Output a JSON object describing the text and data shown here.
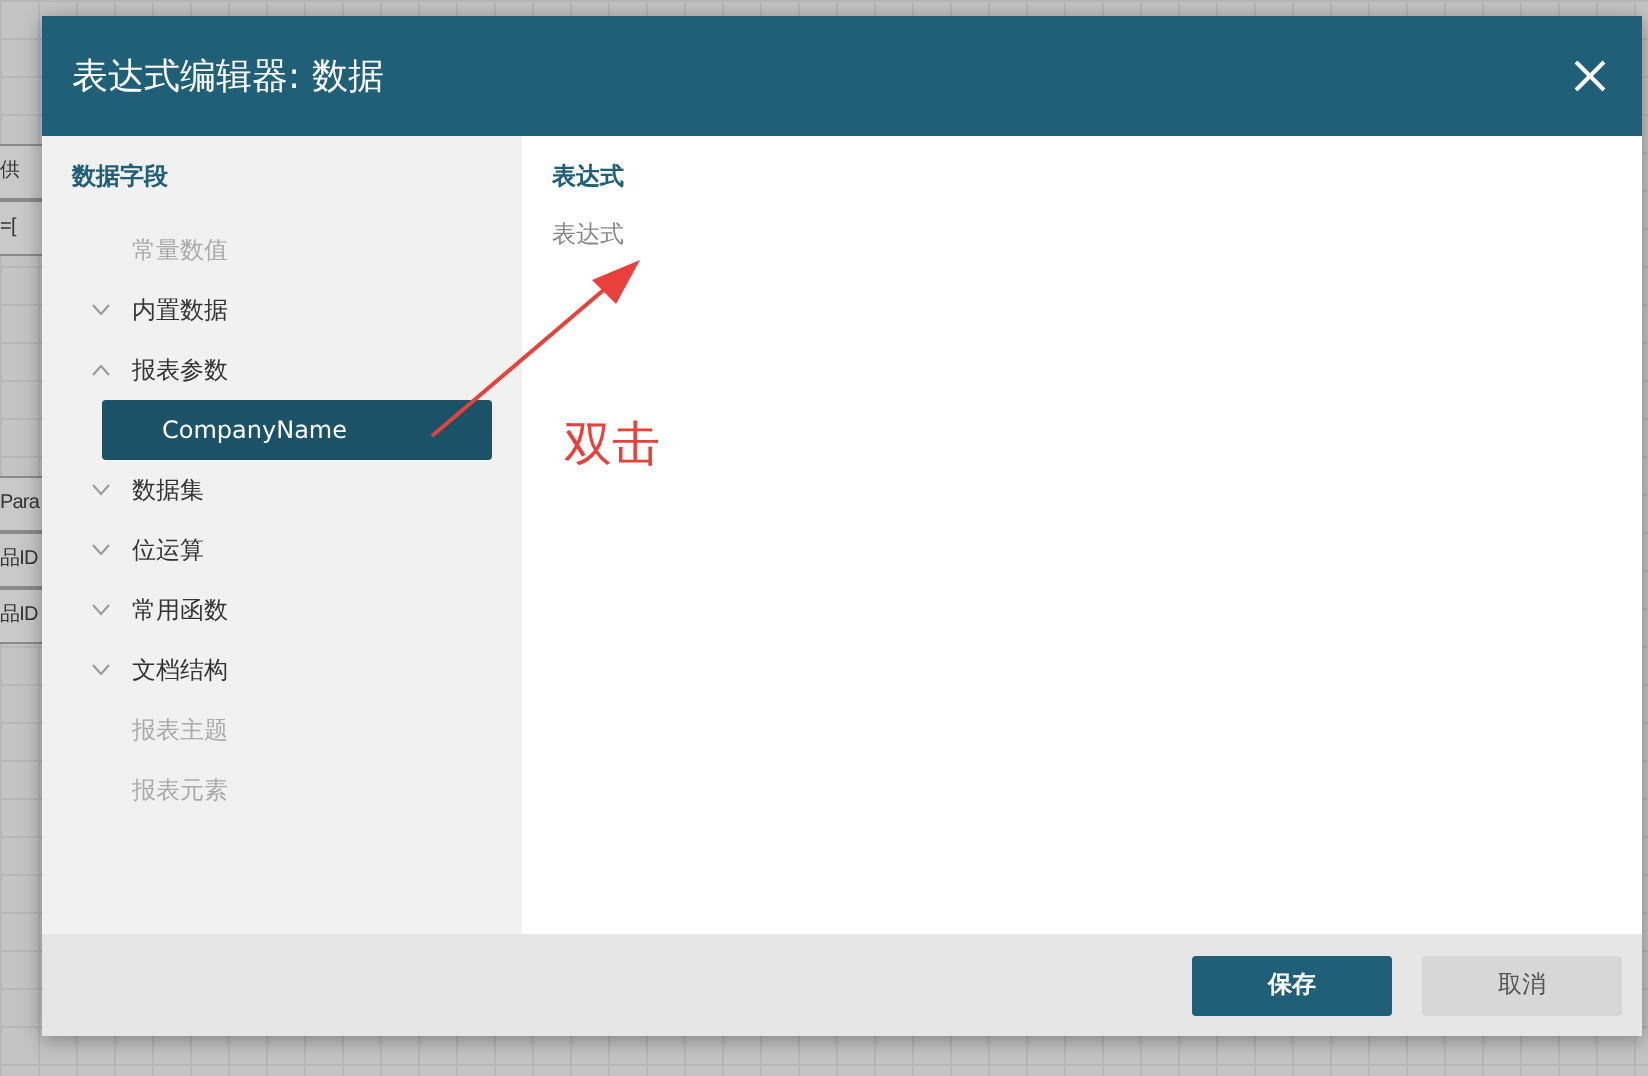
{
  "background": {
    "cells": [
      "供",
      "=[",
      "Para",
      "品ID",
      "品ID"
    ]
  },
  "dialog": {
    "title": "表达式编辑器: 数据",
    "sidebar": {
      "heading": "数据字段",
      "items": [
        {
          "label": "常量数值",
          "disabled": true
        },
        {
          "label": "内置数据",
          "disabled": false,
          "expanded": false
        },
        {
          "label": "报表参数",
          "disabled": false,
          "expanded": true,
          "children": [
            {
              "label": "CompanyName",
              "selected": true
            }
          ]
        },
        {
          "label": "数据集",
          "disabled": false,
          "expanded": false
        },
        {
          "label": "位运算",
          "disabled": false,
          "expanded": false
        },
        {
          "label": "常用函数",
          "disabled": false,
          "expanded": false
        },
        {
          "label": "文档结构",
          "disabled": false,
          "expanded": false
        },
        {
          "label": "报表主题",
          "disabled": true
        },
        {
          "label": "报表元素",
          "disabled": true
        }
      ]
    },
    "editor": {
      "heading": "表达式",
      "placeholder": "表达式"
    },
    "annotation": "双击",
    "buttons": [
      {
        "label": "保存",
        "kind": "primary"
      },
      {
        "label": "取消",
        "kind": "secondary"
      }
    ]
  }
}
